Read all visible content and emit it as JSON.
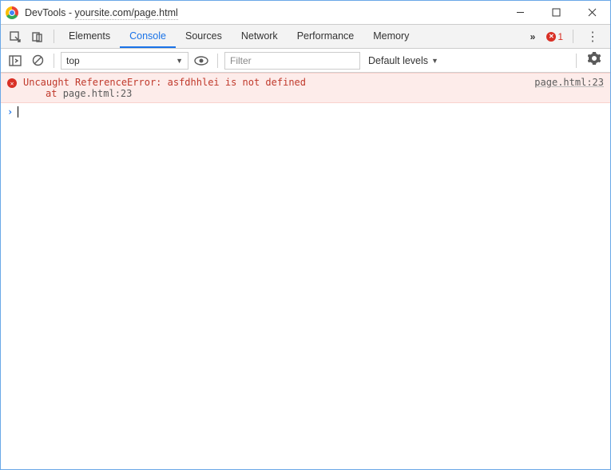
{
  "window": {
    "title_prefix": "DevTools - ",
    "title_url": "yoursite.com/page.html"
  },
  "tabs": {
    "items": [
      "Elements",
      "Console",
      "Sources",
      "Network",
      "Performance",
      "Memory"
    ],
    "active_index": 1,
    "error_count": "1"
  },
  "console_toolbar": {
    "context": "top",
    "filter_placeholder": "Filter",
    "levels_label": "Default levels"
  },
  "error": {
    "message": "Uncaught ReferenceError: asfdhhlei is not defined",
    "at_prefix": "at ",
    "at_location": "page.html:23",
    "source_ref": "page.html:23"
  }
}
